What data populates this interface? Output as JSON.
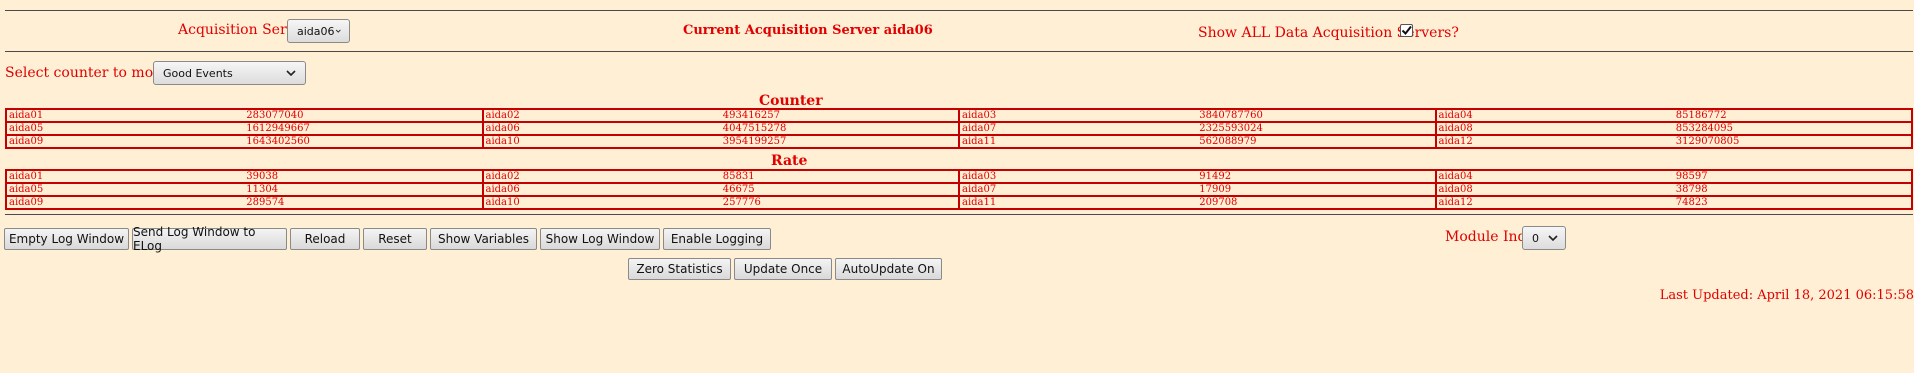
{
  "header": {
    "acq_label": "Acquisition Servers",
    "acq_selected": "aida06",
    "current_server": "Current Acquisition Server aida06",
    "show_all_label": "Show ALL Data Acquisition Servers?",
    "show_all_checked": true
  },
  "counter_select": {
    "label": "Select counter to monitor",
    "selected": "Good Events"
  },
  "counter": {
    "title": "Counter",
    "rows": [
      [
        [
          "aida01",
          "283077040"
        ],
        [
          "aida02",
          "493416257"
        ],
        [
          "aida03",
          "3840787760"
        ],
        [
          "aida04",
          "85186772"
        ]
      ],
      [
        [
          "aida05",
          "1612949667"
        ],
        [
          "aida06",
          "4047515278"
        ],
        [
          "aida07",
          "2325593024"
        ],
        [
          "aida08",
          "853284095"
        ]
      ],
      [
        [
          "aida09",
          "1643402560"
        ],
        [
          "aida10",
          "3954199257"
        ],
        [
          "aida11",
          "562088979"
        ],
        [
          "aida12",
          "3129070805"
        ]
      ]
    ]
  },
  "rate": {
    "title": "Rate",
    "rows": [
      [
        [
          "aida01",
          "39038"
        ],
        [
          "aida02",
          "85831"
        ],
        [
          "aida03",
          "91492"
        ],
        [
          "aida04",
          "98597"
        ]
      ],
      [
        [
          "aida05",
          "11304"
        ],
        [
          "aida06",
          "46675"
        ],
        [
          "aida07",
          "17909"
        ],
        [
          "aida08",
          "38798"
        ]
      ],
      [
        [
          "aida09",
          "289574"
        ],
        [
          "aida10",
          "257776"
        ],
        [
          "aida11",
          "209708"
        ],
        [
          "aida12",
          "74823"
        ]
      ]
    ]
  },
  "toolbar": {
    "empty_log": "Empty Log Window",
    "send_log": "Send Log Window to ELog",
    "reload": "Reload",
    "reset": "Reset",
    "show_variables": "Show Variables",
    "show_log": "Show Log Window",
    "enable_logging": "Enable Logging",
    "module_index_label": "Module Index",
    "module_index_value": "0"
  },
  "stats": {
    "zero": "Zero Statistics",
    "update_once": "Update Once",
    "autoupdate": "AutoUpdate On"
  },
  "footer": {
    "last_updated": "Last Updated: April 18, 2021 06:15:58"
  }
}
